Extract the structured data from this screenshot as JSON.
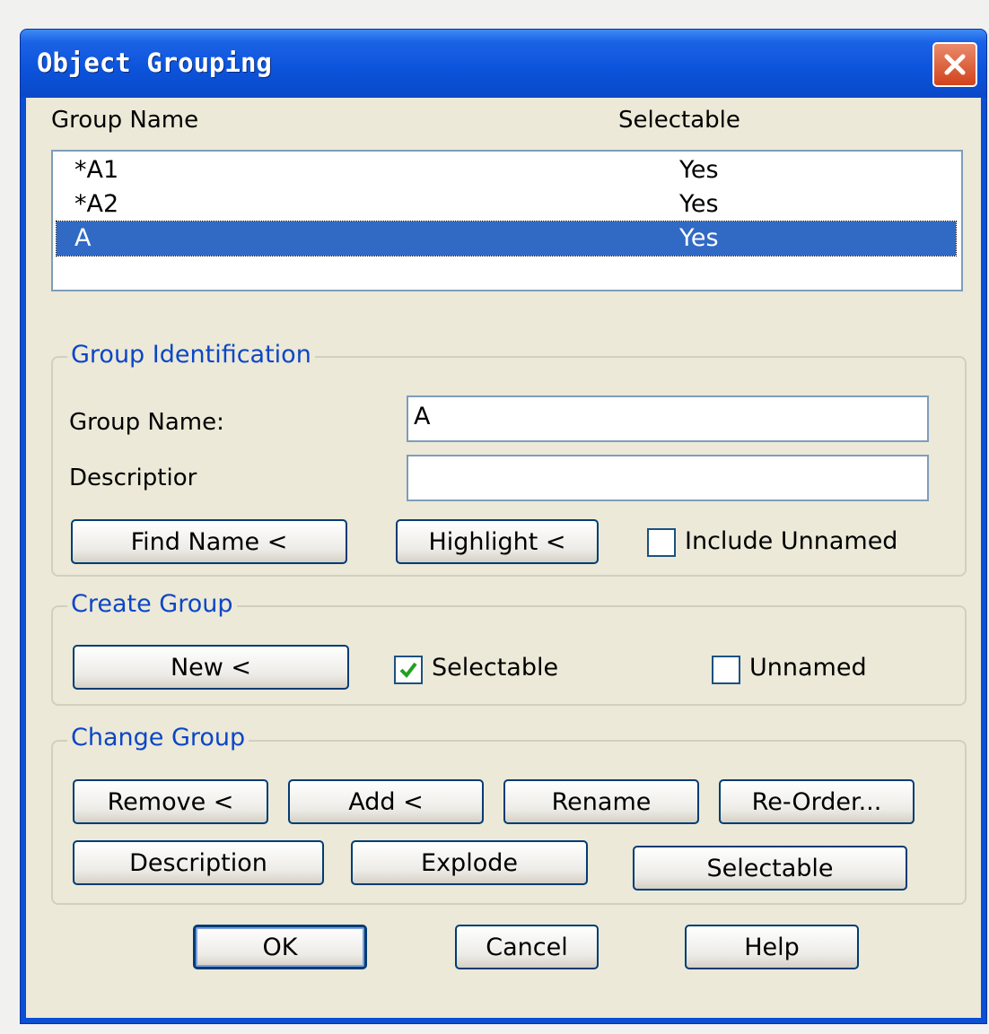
{
  "window": {
    "title": "Object Grouping"
  },
  "list": {
    "headers": {
      "name": "Group Name",
      "selectable": "Selectable"
    },
    "rows": [
      {
        "name": "*A1",
        "selectable": "Yes",
        "selected": false
      },
      {
        "name": "*A2",
        "selectable": "Yes",
        "selected": false
      },
      {
        "name": "A",
        "selectable": "Yes",
        "selected": true
      }
    ]
  },
  "identification": {
    "title": "Group Identification",
    "group_name_label": "Group Name:",
    "group_name_value": "A",
    "description_label": "Descriptior",
    "description_value": "",
    "find_name_button": "Find Name <",
    "highlight_button": "Highlight <",
    "include_unnamed_label": "Include Unnamed",
    "include_unnamed_checked": false
  },
  "create": {
    "title": "Create Group",
    "new_button": "New <",
    "selectable_label": "Selectable",
    "selectable_checked": true,
    "unnamed_label": "Unnamed",
    "unnamed_checked": false
  },
  "change": {
    "title": "Change Group",
    "remove_button": "Remove <",
    "add_button": "Add <",
    "rename_button": "Rename",
    "reorder_button": "Re-Order...",
    "description_button": "Description",
    "explode_button": "Explode",
    "selectable_button": "Selectable"
  },
  "footer": {
    "ok_button": "OK",
    "cancel_button": "Cancel",
    "help_button": "Help"
  },
  "colors": {
    "title_bar": "#0a4fd4",
    "group_title": "#0b46c7",
    "selection": "#316ac5",
    "dialog_bg": "#ece9d8"
  }
}
